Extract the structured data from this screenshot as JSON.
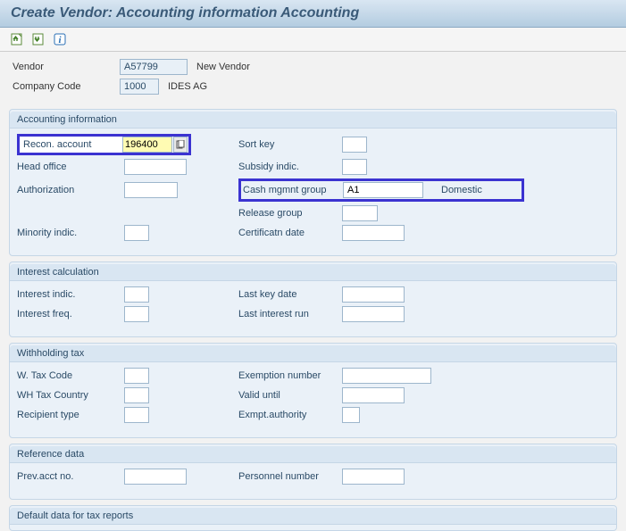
{
  "title": "Create Vendor: Accounting information Accounting",
  "header": {
    "vendor_label": "Vendor",
    "vendor_value": "A57799",
    "vendor_desc": "New Vendor",
    "company_label": "Company Code",
    "company_value": "1000",
    "company_desc": "IDES AG"
  },
  "groups": {
    "accounting": {
      "title": "Accounting information",
      "recon_label": "Recon. account",
      "recon_value": "196400",
      "sort_key_label": "Sort key",
      "sort_key_value": "",
      "head_office_label": "Head office",
      "head_office_value": "",
      "subsidy_label": "Subsidy indic.",
      "subsidy_value": "",
      "authorization_label": "Authorization",
      "authorization_value": "",
      "cash_mgmt_label": "Cash mgmnt group",
      "cash_mgmt_value": "A1",
      "cash_mgmt_desc": "Domestic",
      "release_group_label": "Release group",
      "release_group_value": "",
      "minority_label": "Minority indic.",
      "minority_value": "",
      "cert_date_label": "Certificatn date",
      "cert_date_value": ""
    },
    "interest": {
      "title": "Interest calculation",
      "indic_label": "Interest indic.",
      "indic_value": "",
      "last_key_label": "Last key date",
      "last_key_value": "",
      "freq_label": "Interest freq.",
      "freq_value": "",
      "last_run_label": "Last interest run",
      "last_run_value": ""
    },
    "withholding": {
      "title": "Withholding tax",
      "wtax_label": "W. Tax Code",
      "wtax_value": "",
      "exemption_no_label": "Exemption number",
      "exemption_no_value": "",
      "country_label": "WH Tax Country",
      "country_value": "",
      "valid_until_label": "Valid  until",
      "valid_until_value": "",
      "recipient_label": "Recipient type",
      "recipient_value": "",
      "exmpt_auth_label": "Exmpt.authority",
      "exmpt_auth_value": ""
    },
    "reference": {
      "title": "Reference data",
      "prev_acct_label": "Prev.acct no.",
      "prev_acct_value": "",
      "personnel_label": "Personnel number",
      "personnel_value": ""
    },
    "default_tax": {
      "title": "Default data for tax reports"
    }
  }
}
